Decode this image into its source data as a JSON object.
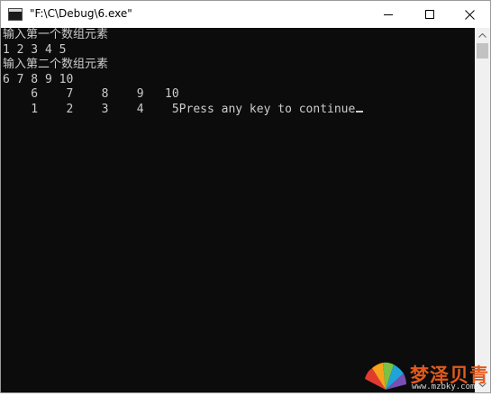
{
  "window": {
    "title": "\"F:\\C\\Debug\\6.exe\""
  },
  "console": {
    "lines": [
      "输入第一个数组元素",
      "1 2 3 4 5",
      "输入第二个数组元素",
      "6 7 8 9 10",
      "    6    7    8    9   10",
      "    1    2    3    4    5Press any key to continue"
    ]
  },
  "watermark": {
    "brand": "梦泽贝青",
    "url": "www.mzbky.com"
  },
  "icons": {
    "app": "console-app-icon",
    "minimize": "minimize-icon",
    "maximize": "maximize-icon",
    "close": "close-icon",
    "scroll_up": "arrow-up-icon",
    "scroll_down": "arrow-down-icon",
    "logo": "fan-logo-icon"
  },
  "colors": {
    "console_bg": "#0c0c0c",
    "console_fg": "#cccccc",
    "brand": "#e25a1c"
  }
}
